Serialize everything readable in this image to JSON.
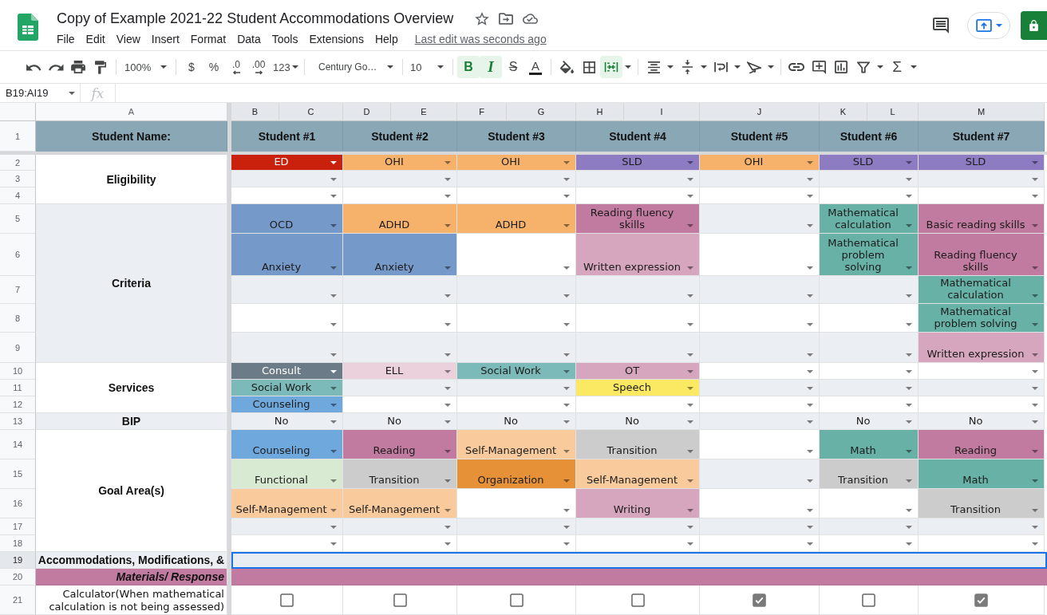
{
  "app": {
    "title": "Copy of Example 2021-22 Student Accommodations Overview",
    "menu": [
      "File",
      "Edit",
      "View",
      "Insert",
      "Format",
      "Data",
      "Tools",
      "Extensions",
      "Help"
    ],
    "last_edit": "Last edit was seconds ago"
  },
  "toolbar": {
    "zoom": "100%",
    "formats": [
      {
        "kind": "currency",
        "label": "$"
      },
      {
        "kind": "percent",
        "label": "%"
      },
      {
        "kind": "decrease_decimal",
        "label": ".0"
      },
      {
        "kind": "increase_decimal",
        "label": ".00"
      },
      {
        "kind": "more_formats",
        "label": "123"
      }
    ],
    "font": "Century Go…",
    "font_size": "10",
    "text_styles": [
      {
        "kind": "bold",
        "label": "B",
        "on": true
      },
      {
        "kind": "italic",
        "label": "I",
        "on": true
      },
      {
        "kind": "strikethrough",
        "label": "S",
        "on": false
      },
      {
        "kind": "text_color",
        "label": "A",
        "on": false
      }
    ],
    "merge_on": true,
    "functions": "Σ"
  },
  "formula_bar": {
    "name_box": "B19:AI19",
    "function_label": "fx"
  },
  "sheet": {
    "columns": [
      {
        "letter": "A",
        "selected": false
      },
      {
        "letter": "B",
        "selected": true
      },
      {
        "letter": "C",
        "selected": true
      },
      {
        "letter": "D",
        "selected": true
      },
      {
        "letter": "E",
        "selected": true
      },
      {
        "letter": "F",
        "selected": true
      },
      {
        "letter": "G",
        "selected": true
      },
      {
        "letter": "H",
        "selected": true
      },
      {
        "letter": "I",
        "selected": true
      },
      {
        "letter": "J",
        "selected": true
      },
      {
        "letter": "K",
        "selected": true
      },
      {
        "letter": "L",
        "selected": true
      },
      {
        "letter": "M",
        "selected": true
      }
    ],
    "row_numbers": [
      {
        "label": "1",
        "selected": false
      },
      {
        "label": "2",
        "selected": false
      },
      {
        "label": "3",
        "selected": false
      },
      {
        "label": "4",
        "selected": false
      },
      {
        "label": "5",
        "selected": false
      },
      {
        "label": "6",
        "selected": false
      },
      {
        "label": "7",
        "selected": false
      },
      {
        "label": "8",
        "selected": false
      },
      {
        "label": "9",
        "selected": false
      },
      {
        "label": "10",
        "selected": false
      },
      {
        "label": "11",
        "selected": false
      },
      {
        "label": "12",
        "selected": false
      },
      {
        "label": "13",
        "selected": false
      },
      {
        "label": "14",
        "selected": false
      },
      {
        "label": "15",
        "selected": false
      },
      {
        "label": "16",
        "selected": false
      },
      {
        "label": "17",
        "selected": false
      },
      {
        "label": "18",
        "selected": false
      },
      {
        "label": "19",
        "selected": true
      },
      {
        "label": "20",
        "selected": false
      },
      {
        "label": "21",
        "selected": false
      }
    ],
    "header": {
      "label": "Student Name:",
      "students": [
        "Student #1",
        "Student #2",
        "Student #3",
        "Student #4",
        "Student #5",
        "Student #6",
        "Student #7"
      ]
    },
    "sections": [
      {
        "label": "Eligibility",
        "rows": [
          {
            "cells": [
              {
                "text": "ED",
                "color": "#c9210c"
              },
              {
                "text": "OHI",
                "color": "#f6b26b"
              },
              {
                "text": "OHI",
                "color": "#f6b26b"
              },
              {
                "text": "SLD",
                "color": "#8e7cc3"
              },
              {
                "text": "OHI",
                "color": "#f6b26b"
              },
              {
                "text": "SLD",
                "color": "#8e7cc3"
              },
              {
                "text": "SLD",
                "color": "#8e7cc3"
              }
            ]
          },
          {
            "cells": [
              {},
              {},
              {},
              {},
              {},
              {},
              {}
            ]
          },
          {
            "cells": [
              {},
              {},
              {},
              {},
              {},
              {},
              {}
            ]
          }
        ]
      },
      {
        "label": "Criteria",
        "rows": [
          {
            "cells": [
              {
                "text": "OCD",
                "color": "#7599c9"
              },
              {
                "text": "ADHD",
                "color": "#f6b26b"
              },
              {
                "text": "ADHD",
                "color": "#f6b26b"
              },
              {
                "text": "Reading fluency skills",
                "color": "#c27ba0"
              },
              {},
              {
                "text": "Mathematical calculation",
                "color": "#67b1a6"
              },
              {
                "text": "Basic reading skills",
                "color": "#c27ba0"
              }
            ]
          },
          {
            "cells": [
              {
                "text": "Anxiety",
                "color": "#7599c9"
              },
              {
                "text": "Anxiety",
                "color": "#7599c9"
              },
              {},
              {
                "text": "Written expression",
                "color": "#d5a6bd"
              },
              {},
              {
                "text": "Mathematical problem solving",
                "color": "#67b1a6"
              },
              {
                "text": "Reading fluency skills",
                "color": "#c27ba0"
              }
            ]
          },
          {
            "cells": [
              {},
              {},
              {},
              {},
              {},
              {},
              {
                "text": "Mathematical calculation",
                "color": "#67b1a6"
              }
            ]
          },
          {
            "cells": [
              {},
              {},
              {},
              {},
              {},
              {},
              {
                "text": "Mathematical problem solving",
                "color": "#67b1a6"
              }
            ]
          },
          {
            "cells": [
              {},
              {},
              {},
              {},
              {},
              {},
              {
                "text": "Written expression",
                "color": "#d5a6bd"
              }
            ]
          }
        ]
      },
      {
        "label": "Services",
        "rows": [
          {
            "cells": [
              {
                "text": "Consult",
                "color": "#6b7c88"
              },
              {
                "text": "ELL",
                "color": "#ead1dc"
              },
              {
                "text": "Social Work",
                "color": "#7bbab9"
              },
              {
                "text": "OT",
                "color": "#d5a6bd"
              },
              {},
              {},
              {}
            ]
          },
          {
            "cells": [
              {
                "text": "Social Work",
                "color": "#7bbab9"
              },
              {},
              {},
              {
                "text": "Speech",
                "color": "#fbe863"
              },
              {},
              {},
              {}
            ]
          },
          {
            "cells": [
              {
                "text": "Counseling",
                "color": "#6fa8dc"
              },
              {},
              {},
              {},
              {},
              {},
              {}
            ]
          }
        ]
      },
      {
        "label": "BIP",
        "rows": [
          {
            "cells": [
              {
                "text": "No"
              },
              {
                "text": "No"
              },
              {
                "text": "No"
              },
              {
                "text": "No"
              },
              {},
              {
                "text": "No"
              },
              {
                "text": "No"
              }
            ]
          }
        ]
      },
      {
        "label": "Goal Area(s)",
        "rows": [
          {
            "cells": [
              {
                "text": "Counseling",
                "color": "#6fa8dc"
              },
              {
                "text": "Reading",
                "color": "#c27ba0"
              },
              {
                "text": "Self-Management",
                "color": "#f9cb9c"
              },
              {
                "text": "Transition",
                "color": "#cccccc"
              },
              {},
              {
                "text": "Math",
                "color": "#67b1a6"
              },
              {
                "text": "Reading",
                "color": "#c27ba0"
              }
            ]
          },
          {
            "cells": [
              {
                "text": "Functional",
                "color": "#d9ead3"
              },
              {
                "text": "Transition",
                "color": "#cccccc"
              },
              {
                "text": "Organization",
                "color": "#e69138"
              },
              {
                "text": "Self-Management",
                "color": "#f9cb9c"
              },
              {},
              {
                "text": "Transition",
                "color": "#cccccc"
              },
              {
                "text": "Math",
                "color": "#67b1a6"
              }
            ]
          },
          {
            "cells": [
              {
                "text": "Self-Management",
                "color": "#f9cb9c"
              },
              {
                "text": "Self-Management",
                "color": "#f9cb9c"
              },
              {},
              {
                "text": "Writing",
                "color": "#d5a6bd"
              },
              {},
              {},
              {
                "text": "Transition",
                "color": "#cccccc"
              }
            ]
          },
          {
            "cells": [
              {},
              {},
              {},
              {},
              {},
              {},
              {}
            ]
          },
          {
            "cells": [
              {},
              {},
              {},
              {},
              {},
              {},
              {}
            ]
          }
        ]
      }
    ],
    "bottom_rows": [
      {
        "kind": "heading",
        "label": "Accommodations, Modifications, &"
      },
      {
        "kind": "subheading",
        "label": "Materials/ Response"
      },
      {
        "kind": "checkbox",
        "label": "Calculator(When mathematical calculation is not being assessed)",
        "cells": [
          {
            "checked": false
          },
          {
            "checked": false
          },
          {
            "checked": false
          },
          {
            "checked": false
          },
          {
            "checked": true
          },
          {
            "checked": false
          },
          {
            "checked": true
          }
        ]
      }
    ]
  }
}
